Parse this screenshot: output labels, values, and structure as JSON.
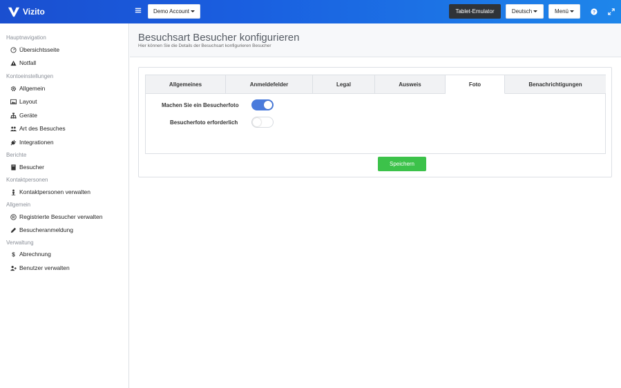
{
  "brand": {
    "name": "Vizito"
  },
  "topbar": {
    "account_label": "Demo Account",
    "tablet_label": "Tablet-Emulator",
    "language_label": "Deutsch",
    "menu_label": "Menü"
  },
  "sidebar": {
    "sections": [
      {
        "title": "Hauptnavigation",
        "items": [
          {
            "label": "Übersichtsseite",
            "icon": "dashboard-icon"
          },
          {
            "label": "Notfall",
            "icon": "warning-icon"
          }
        ]
      },
      {
        "title": "Kontoeinstellungen",
        "items": [
          {
            "label": "Allgemein",
            "icon": "gear-icon"
          },
          {
            "label": "Layout",
            "icon": "image-icon"
          },
          {
            "label": "Geräte",
            "icon": "sitemap-icon"
          },
          {
            "label": "Art des Besuches",
            "icon": "users-icon"
          },
          {
            "label": "Integrationen",
            "icon": "plug-icon"
          }
        ]
      },
      {
        "title": "Berichte",
        "items": [
          {
            "label": "Besucher",
            "icon": "book-icon"
          }
        ]
      },
      {
        "title": "Kontaktpersonen",
        "items": [
          {
            "label": "Kontaktpersonen verwalten",
            "icon": "person-icon"
          }
        ]
      },
      {
        "title": "Allgemein",
        "items": [
          {
            "label": "Registrierte Besucher verwalten",
            "icon": "registered-icon"
          },
          {
            "label": "Besucheranmeldung",
            "icon": "pencil-icon"
          }
        ]
      },
      {
        "title": "Verwaltung",
        "items": [
          {
            "label": "Abrechnung",
            "icon": "dollar-icon"
          },
          {
            "label": "Benutzer verwalten",
            "icon": "user-plus-icon"
          }
        ]
      }
    ]
  },
  "page": {
    "title": "Besuchsart Besucher konfigurieren",
    "subtitle": "Hier können Sie die Details der Besuchsart konfigurieren Besucher"
  },
  "tabs": [
    {
      "label": "Allgemeines",
      "active": false
    },
    {
      "label": "Anmeldefelder",
      "active": false
    },
    {
      "label": "Legal",
      "active": false
    },
    {
      "label": "Ausweis",
      "active": false
    },
    {
      "label": "Foto",
      "active": true
    },
    {
      "label": "Benachrichtigungen",
      "active": false
    }
  ],
  "settings": {
    "photo_label": "Machen Sie ein Besucherfoto",
    "photo_enabled": true,
    "photo_required_label": "Besucherfoto erforderlich",
    "photo_required": false
  },
  "actions": {
    "save_label": "Speichern"
  },
  "colors": {
    "accent": "#4a7bdc",
    "save": "#3cc24a",
    "topbar": "#1a5fe0"
  }
}
